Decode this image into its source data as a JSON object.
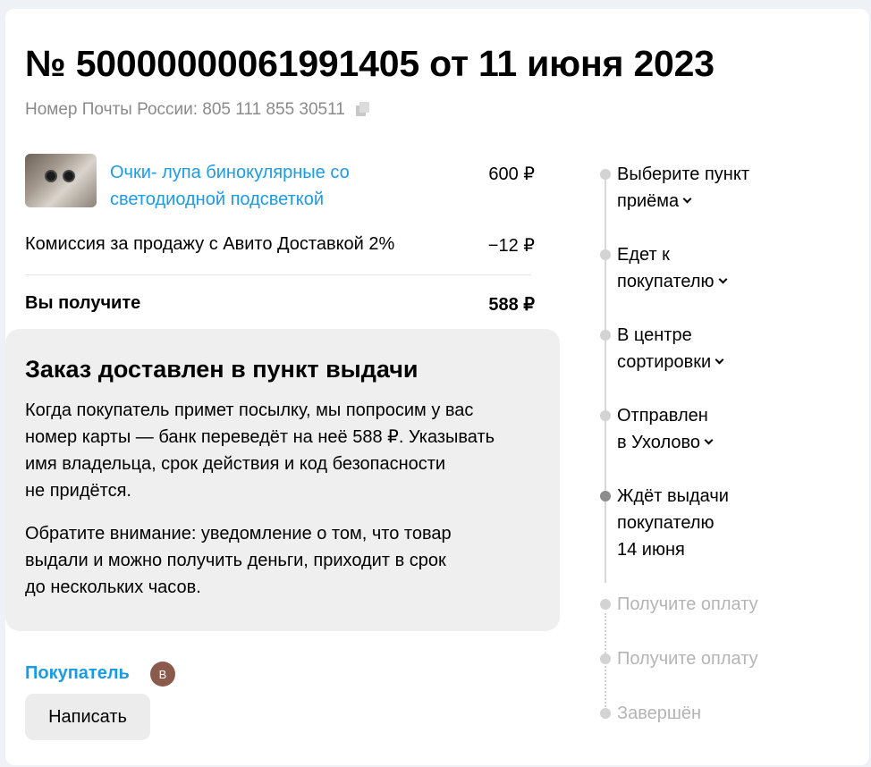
{
  "order": {
    "title": "№ 50000000061991405 от 11 июня 2023",
    "post_label": "Номер Почты России: 805 111 855 30511"
  },
  "item": {
    "name": "Очки- лупа бинокулярные со светодиодной подсветкой",
    "price": "600 ₽"
  },
  "fee": {
    "label": "Комиссия за продажу с Авито Доставкой 2%",
    "value": "−12 ₽"
  },
  "total": {
    "label": "Вы получите",
    "value": "588 ₽"
  },
  "info": {
    "title": "Заказ доставлен в пункт выдачи",
    "p1_lines": [
      "Когда покупатель примет посылку, мы попросим у вас",
      "номер карты — банк переведёт на неё 588 ₽. Указывать",
      "имя владельца, срок действия и код безопасности",
      "не придётся."
    ],
    "p2_lines": [
      "Обратите внимание: уведомление о том, что товар",
      "выдали и можно получить деньги, приходит в срок",
      "до нескольких часов."
    ]
  },
  "buyer": {
    "label": "Покупатель",
    "avatar_letter": "В"
  },
  "actions": {
    "write_label": "Написать"
  },
  "timeline": [
    {
      "line1": "Выберите пункт",
      "line2": "приёма",
      "status": "done"
    },
    {
      "line1": "Едет к",
      "line2": "покупателю",
      "status": "done"
    },
    {
      "line1": "В центре",
      "line2": "сортировки",
      "status": "done"
    },
    {
      "line1": "Отправлен",
      "line2": "в Ухолово",
      "status": "done"
    },
    {
      "line1": "Ждёт выдачи",
      "line2": "покупателю",
      "date": "14 июня",
      "status": "current"
    },
    {
      "line1": "Получите оплату",
      "status": "pending"
    },
    {
      "line1": "Получите оплату",
      "status": "pending"
    },
    {
      "line1": "Завершён",
      "status": "pending"
    }
  ],
  "colors": {
    "link": "#1a9be8",
    "muted": "#b4b4b4",
    "box_bg": "#efefef",
    "avatar": "#8b5a4c"
  }
}
